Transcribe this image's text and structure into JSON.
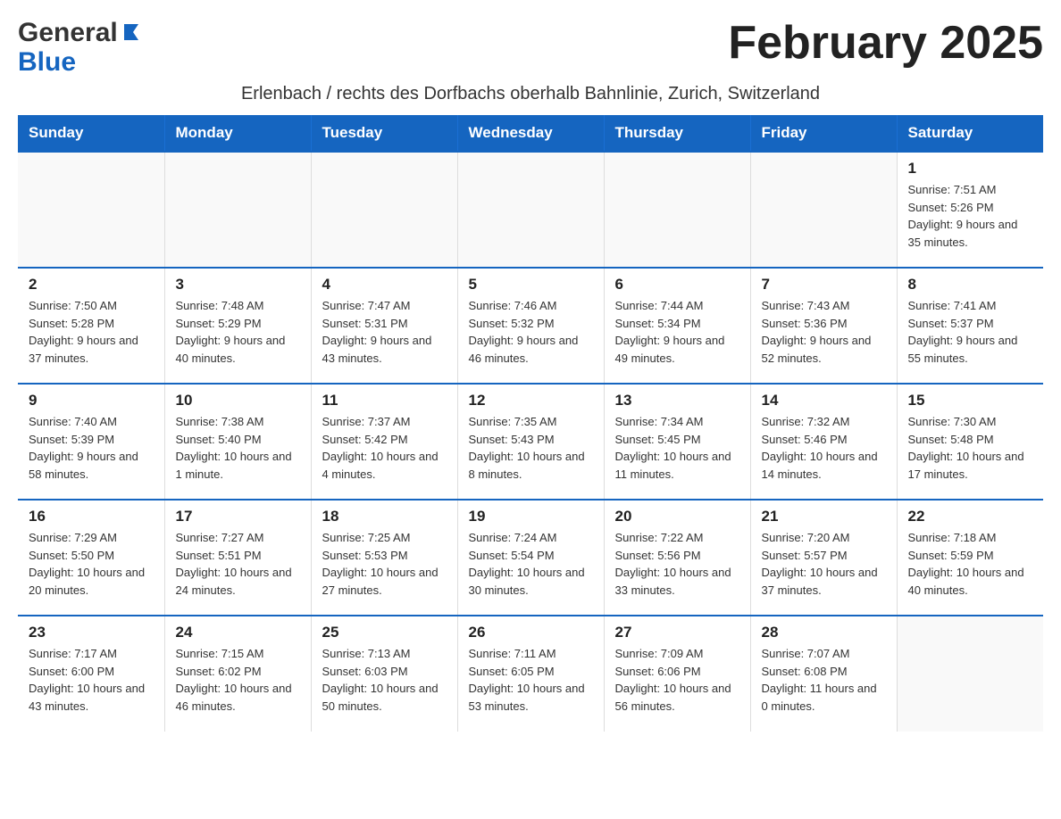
{
  "header": {
    "title": "February 2025",
    "subtitle": "Erlenbach / rechts des Dorfbachs oberhalb Bahnlinie, Zurich, Switzerland",
    "logo_general": "General",
    "logo_blue": "Blue"
  },
  "calendar": {
    "days_of_week": [
      "Sunday",
      "Monday",
      "Tuesday",
      "Wednesday",
      "Thursday",
      "Friday",
      "Saturday"
    ],
    "weeks": [
      {
        "days": [
          {
            "date": "",
            "info": ""
          },
          {
            "date": "",
            "info": ""
          },
          {
            "date": "",
            "info": ""
          },
          {
            "date": "",
            "info": ""
          },
          {
            "date": "",
            "info": ""
          },
          {
            "date": "",
            "info": ""
          },
          {
            "date": "1",
            "info": "Sunrise: 7:51 AM\nSunset: 5:26 PM\nDaylight: 9 hours and 35 minutes."
          }
        ]
      },
      {
        "days": [
          {
            "date": "2",
            "info": "Sunrise: 7:50 AM\nSunset: 5:28 PM\nDaylight: 9 hours and 37 minutes."
          },
          {
            "date": "3",
            "info": "Sunrise: 7:48 AM\nSunset: 5:29 PM\nDaylight: 9 hours and 40 minutes."
          },
          {
            "date": "4",
            "info": "Sunrise: 7:47 AM\nSunset: 5:31 PM\nDaylight: 9 hours and 43 minutes."
          },
          {
            "date": "5",
            "info": "Sunrise: 7:46 AM\nSunset: 5:32 PM\nDaylight: 9 hours and 46 minutes."
          },
          {
            "date": "6",
            "info": "Sunrise: 7:44 AM\nSunset: 5:34 PM\nDaylight: 9 hours and 49 minutes."
          },
          {
            "date": "7",
            "info": "Sunrise: 7:43 AM\nSunset: 5:36 PM\nDaylight: 9 hours and 52 minutes."
          },
          {
            "date": "8",
            "info": "Sunrise: 7:41 AM\nSunset: 5:37 PM\nDaylight: 9 hours and 55 minutes."
          }
        ]
      },
      {
        "days": [
          {
            "date": "9",
            "info": "Sunrise: 7:40 AM\nSunset: 5:39 PM\nDaylight: 9 hours and 58 minutes."
          },
          {
            "date": "10",
            "info": "Sunrise: 7:38 AM\nSunset: 5:40 PM\nDaylight: 10 hours and 1 minute."
          },
          {
            "date": "11",
            "info": "Sunrise: 7:37 AM\nSunset: 5:42 PM\nDaylight: 10 hours and 4 minutes."
          },
          {
            "date": "12",
            "info": "Sunrise: 7:35 AM\nSunset: 5:43 PM\nDaylight: 10 hours and 8 minutes."
          },
          {
            "date": "13",
            "info": "Sunrise: 7:34 AM\nSunset: 5:45 PM\nDaylight: 10 hours and 11 minutes."
          },
          {
            "date": "14",
            "info": "Sunrise: 7:32 AM\nSunset: 5:46 PM\nDaylight: 10 hours and 14 minutes."
          },
          {
            "date": "15",
            "info": "Sunrise: 7:30 AM\nSunset: 5:48 PM\nDaylight: 10 hours and 17 minutes."
          }
        ]
      },
      {
        "days": [
          {
            "date": "16",
            "info": "Sunrise: 7:29 AM\nSunset: 5:50 PM\nDaylight: 10 hours and 20 minutes."
          },
          {
            "date": "17",
            "info": "Sunrise: 7:27 AM\nSunset: 5:51 PM\nDaylight: 10 hours and 24 minutes."
          },
          {
            "date": "18",
            "info": "Sunrise: 7:25 AM\nSunset: 5:53 PM\nDaylight: 10 hours and 27 minutes."
          },
          {
            "date": "19",
            "info": "Sunrise: 7:24 AM\nSunset: 5:54 PM\nDaylight: 10 hours and 30 minutes."
          },
          {
            "date": "20",
            "info": "Sunrise: 7:22 AM\nSunset: 5:56 PM\nDaylight: 10 hours and 33 minutes."
          },
          {
            "date": "21",
            "info": "Sunrise: 7:20 AM\nSunset: 5:57 PM\nDaylight: 10 hours and 37 minutes."
          },
          {
            "date": "22",
            "info": "Sunrise: 7:18 AM\nSunset: 5:59 PM\nDaylight: 10 hours and 40 minutes."
          }
        ]
      },
      {
        "days": [
          {
            "date": "23",
            "info": "Sunrise: 7:17 AM\nSunset: 6:00 PM\nDaylight: 10 hours and 43 minutes."
          },
          {
            "date": "24",
            "info": "Sunrise: 7:15 AM\nSunset: 6:02 PM\nDaylight: 10 hours and 46 minutes."
          },
          {
            "date": "25",
            "info": "Sunrise: 7:13 AM\nSunset: 6:03 PM\nDaylight: 10 hours and 50 minutes."
          },
          {
            "date": "26",
            "info": "Sunrise: 7:11 AM\nSunset: 6:05 PM\nDaylight: 10 hours and 53 minutes."
          },
          {
            "date": "27",
            "info": "Sunrise: 7:09 AM\nSunset: 6:06 PM\nDaylight: 10 hours and 56 minutes."
          },
          {
            "date": "28",
            "info": "Sunrise: 7:07 AM\nSunset: 6:08 PM\nDaylight: 11 hours and 0 minutes."
          },
          {
            "date": "",
            "info": ""
          }
        ]
      }
    ]
  }
}
